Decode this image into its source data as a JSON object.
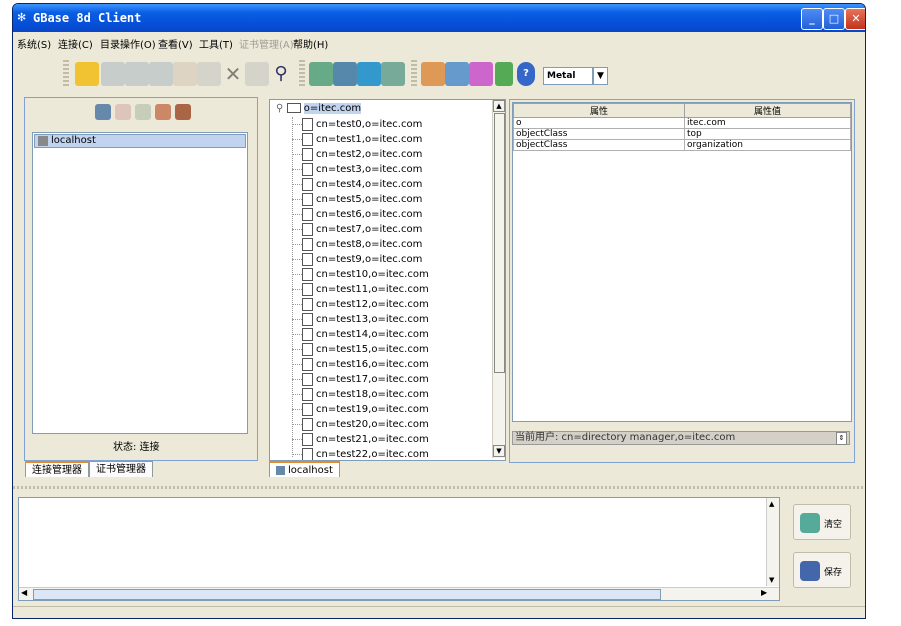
{
  "window": {
    "title": "GBase 8d Client",
    "icon": "app-icon",
    "controls": [
      "minimize-icon",
      "maximize-icon",
      "close-icon"
    ]
  },
  "menu": [
    {
      "label": "系统(S)",
      "enabled": true
    },
    {
      "label": "连接(C)",
      "enabled": true
    },
    {
      "label": "目录操作(O)",
      "enabled": true
    },
    {
      "label": "查看(V)",
      "enabled": true
    },
    {
      "label": "工具(T)",
      "enabled": true
    },
    {
      "label": "证书管理(A)",
      "enabled": false
    },
    {
      "label": "帮助(H)",
      "enabled": true
    }
  ],
  "toolbar": {
    "look_and_feel": "Metal"
  },
  "left_panel": {
    "connection": "localhost",
    "status": "状态: 连接",
    "tabs": [
      "连接管理器",
      "证书管理器"
    ]
  },
  "tree": {
    "root": "o=itec.com",
    "children": [
      "cn=test0,o=itec.com",
      "cn=test1,o=itec.com",
      "cn=test2,o=itec.com",
      "cn=test3,o=itec.com",
      "cn=test4,o=itec.com",
      "cn=test5,o=itec.com",
      "cn=test6,o=itec.com",
      "cn=test7,o=itec.com",
      "cn=test8,o=itec.com",
      "cn=test9,o=itec.com",
      "cn=test10,o=itec.com",
      "cn=test11,o=itec.com",
      "cn=test12,o=itec.com",
      "cn=test13,o=itec.com",
      "cn=test14,o=itec.com",
      "cn=test15,o=itec.com",
      "cn=test16,o=itec.com",
      "cn=test17,o=itec.com",
      "cn=test18,o=itec.com",
      "cn=test19,o=itec.com",
      "cn=test20,o=itec.com",
      "cn=test21,o=itec.com",
      "cn=test22,o=itec.com"
    ],
    "tab": "localhost"
  },
  "properties": {
    "headers": [
      "属性",
      "属性值"
    ],
    "rows": [
      [
        "o",
        "itec.com"
      ],
      [
        "objectClass",
        "top"
      ],
      [
        "objectClass",
        "organization"
      ]
    ],
    "current_user": "当前用户: cn=directory manager,o=itec.com"
  },
  "bottom": {
    "clear_label": "清空",
    "save_label": "保存"
  },
  "colors": {
    "title_bar": "#0a5fe3",
    "window_bg": "#ece9d8",
    "panel_border": "#7fa1d3"
  }
}
